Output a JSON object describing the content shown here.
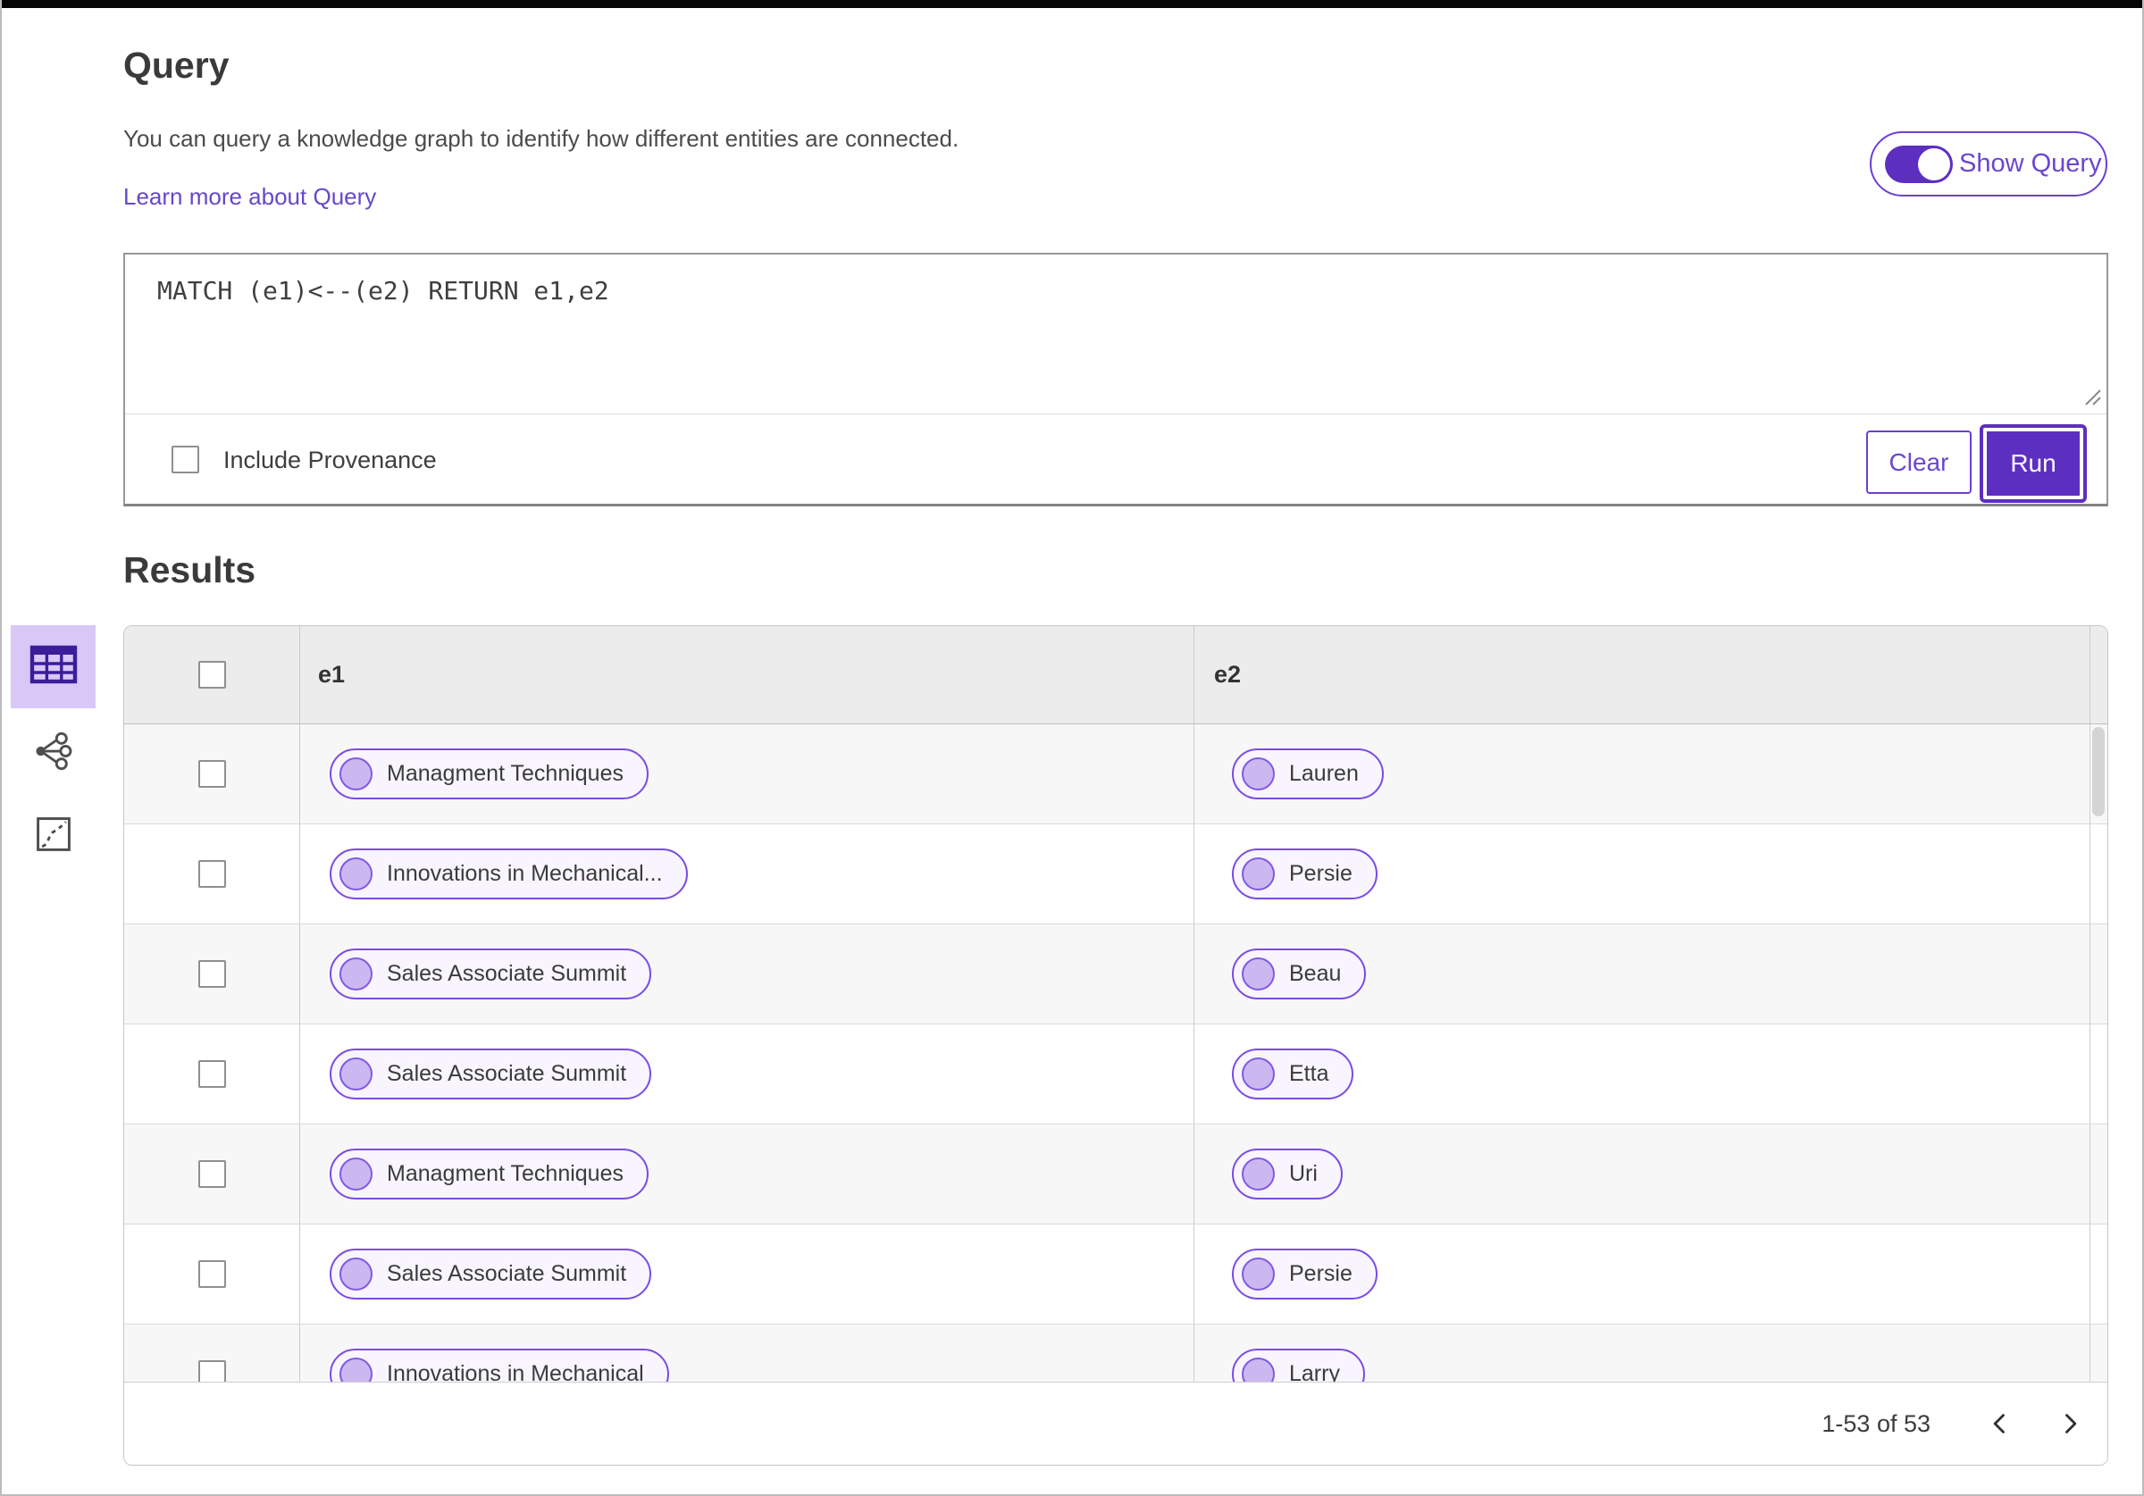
{
  "query": {
    "title": "Query",
    "description": "You can query a knowledge graph to identify how different entities are connected.",
    "learn_more_link": "Learn more about Query",
    "show_query_label": "Show Query",
    "show_query_state": "on",
    "query_text": "MATCH (e1)<--(e2) RETURN e1,e2",
    "include_provenance_label": "Include Provenance",
    "include_provenance_checked": false,
    "clear_button": "Clear",
    "run_button": "Run"
  },
  "results": {
    "title": "Results",
    "columns": [
      "e1",
      "e2"
    ],
    "rows": [
      {
        "e1": "Managment Techniques",
        "e2": "Lauren"
      },
      {
        "e1": "Innovations in Mechanical...",
        "e2": "Persie"
      },
      {
        "e1": "Sales Associate Summit",
        "e2": "Beau"
      },
      {
        "e1": "Sales Associate Summit",
        "e2": "Etta"
      },
      {
        "e1": "Managment Techniques",
        "e2": "Uri"
      },
      {
        "e1": "Sales Associate Summit",
        "e2": "Persie"
      },
      {
        "e1": "Innovations in Mechanical",
        "e2": "Larry"
      }
    ],
    "views": [
      {
        "name": "table-view",
        "selected": true
      },
      {
        "name": "network-view",
        "selected": false
      },
      {
        "name": "chart-view",
        "selected": false
      }
    ],
    "pagination": {
      "range_label": "1-53 of 53"
    }
  },
  "colors": {
    "accent": "#5d2fc1",
    "pill_border": "#7a4ce2",
    "pill_dot": "#ccb8f1",
    "pill_bg": "#f8f5fe",
    "link": "#6548c9",
    "selected_tile_bg": "#d8c7f7",
    "table_header_bg": "#ececec",
    "row_alt_bg": "#f7f7f7"
  }
}
